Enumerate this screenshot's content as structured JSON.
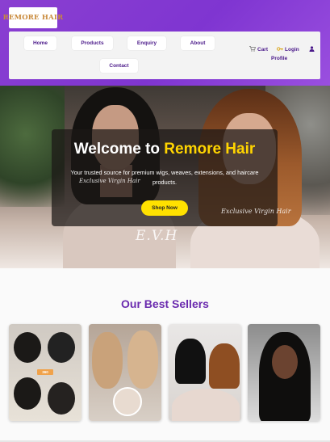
{
  "brand": {
    "logo_text": "REMORE HAIR",
    "color": "#c98a3b"
  },
  "nav": {
    "items": [
      {
        "label": "Home"
      },
      {
        "label": "Products"
      },
      {
        "label": "Enquiry"
      },
      {
        "label": "About"
      },
      {
        "label": "Contact"
      }
    ],
    "cart_label": "Cart",
    "login_label": "Login",
    "profile_label": "Profile",
    "cart_icon": "cart-icon",
    "login_icon": "key-icon",
    "profile_icon": "user-icon"
  },
  "hero": {
    "title_prefix": "Welcome to",
    "title_brand": "Remore Hair",
    "subtitle": "Your trusted source for premium wigs, weaves, extensions, and haircare products.",
    "cta_label": "Shop Now",
    "watermark_left": "Exclusive Virgin Hair",
    "watermark_right": "Exclusive Virgin Hair",
    "watermark_bottom": "E.V.H",
    "brand_color": "#ffd400",
    "cta_color": "#ffe100"
  },
  "best_sellers": {
    "title": "Our Best Sellers",
    "badge_text": "360",
    "title_color": "#6a2aae"
  },
  "theme": {
    "header_color": "#8a3fd1",
    "nav_text_color": "#4b1a8a"
  }
}
